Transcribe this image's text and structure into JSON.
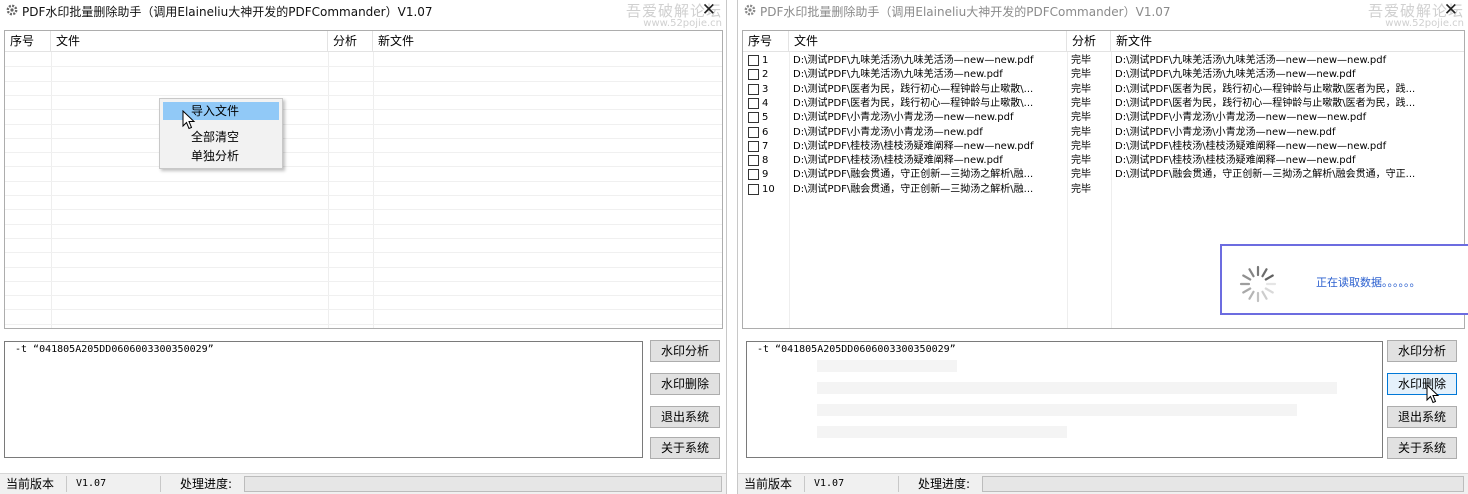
{
  "app": {
    "title": "PDF水印批量删除助手（调用Elaineliu大神开发的PDFCommander）V1.07",
    "watermark_line1": "吾爱破解论坛",
    "watermark_line2": "www.52pojie.cn",
    "close_glyph": "✕"
  },
  "columns": {
    "index": "序号",
    "file": "文件",
    "analysis": "分析",
    "new_file": "新文件"
  },
  "context_menu": {
    "items": [
      {
        "label": "导入文件",
        "highlighted": true
      },
      {
        "label": "全部清空",
        "highlighted": false
      },
      {
        "label": "单独分析",
        "highlighted": false
      }
    ]
  },
  "command": {
    "text": "-t “041805A205DD0606003300350029”"
  },
  "buttons": {
    "analyze": "水印分析",
    "delete": "水印删除",
    "exit": "退出系统",
    "about": "关于系统"
  },
  "status": {
    "version_label": "当前版本",
    "version_value": "V1.07",
    "progress_label": "处理进度:",
    "progress": 0
  },
  "rows": [
    {
      "index": "1",
      "file": "D:\\测试PDF\\九味羌活汤\\九味羌活汤—new—new.pdf",
      "analysis": "完毕",
      "new_file": "D:\\测试PDF\\九味羌活汤\\九味羌活汤—new—new—new.pdf"
    },
    {
      "index": "2",
      "file": "D:\\测试PDF\\九味羌活汤\\九味羌活汤—new.pdf",
      "analysis": "完毕",
      "new_file": "D:\\测试PDF\\九味羌活汤\\九味羌活汤—new—new.pdf"
    },
    {
      "index": "3",
      "file": "D:\\测试PDF\\医者为民，践行初心—程钟龄与止嗽散\\...",
      "analysis": "完毕",
      "new_file": "D:\\测试PDF\\医者为民，践行初心—程钟龄与止嗽散\\医者为民，践..."
    },
    {
      "index": "4",
      "file": "D:\\测试PDF\\医者为民，践行初心—程钟龄与止嗽散\\...",
      "analysis": "完毕",
      "new_file": "D:\\测试PDF\\医者为民，践行初心—程钟龄与止嗽散\\医者为民，践..."
    },
    {
      "index": "5",
      "file": "D:\\测试PDF\\小青龙汤\\小青龙汤—new—new.pdf",
      "analysis": "完毕",
      "new_file": "D:\\测试PDF\\小青龙汤\\小青龙汤—new—new—new.pdf"
    },
    {
      "index": "6",
      "file": "D:\\测试PDF\\小青龙汤\\小青龙汤—new.pdf",
      "analysis": "完毕",
      "new_file": "D:\\测试PDF\\小青龙汤\\小青龙汤—new—new.pdf"
    },
    {
      "index": "7",
      "file": "D:\\测试PDF\\桂枝汤\\桂枝汤疑难阐释—new—new.pdf",
      "analysis": "完毕",
      "new_file": "D:\\测试PDF\\桂枝汤\\桂枝汤疑难阐释—new—new—new.pdf"
    },
    {
      "index": "8",
      "file": "D:\\测试PDF\\桂枝汤\\桂枝汤疑难阐释—new.pdf",
      "analysis": "完毕",
      "new_file": "D:\\测试PDF\\桂枝汤\\桂枝汤疑难阐释—new—new.pdf"
    },
    {
      "index": "9",
      "file": "D:\\测试PDF\\融会贯通，守正创新—三拗汤之解析\\融...",
      "analysis": "完毕",
      "new_file": "D:\\测试PDF\\融会贯通，守正创新—三拗汤之解析\\融会贯通，守正..."
    },
    {
      "index": "10",
      "file": "D:\\测试PDF\\融会贯通，守正创新—三拗汤之解析\\融...",
      "analysis": "完毕",
      "new_file": ""
    }
  ],
  "loading": {
    "text": "正在读取数据。。。。。。"
  },
  "colors": {
    "highlight": "#91c9f7",
    "loading_border": "#6c6ce0",
    "loading_text": "#2a5fcf"
  }
}
